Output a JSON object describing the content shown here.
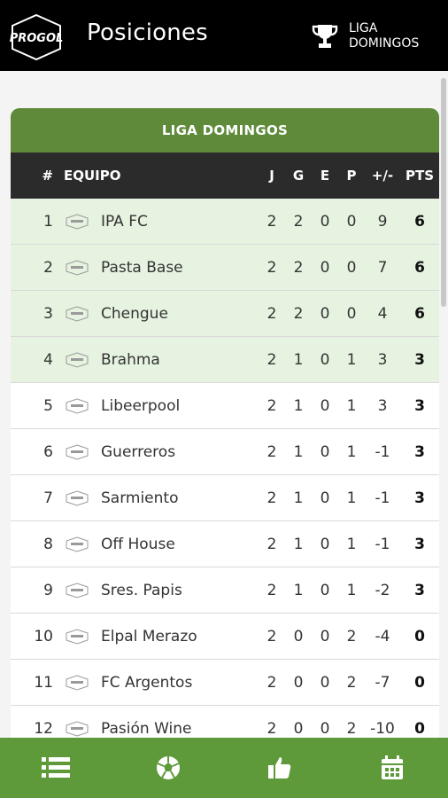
{
  "header": {
    "logo_text": "PROGOL",
    "title": "Posiciones",
    "league_button_label": "LIGA\nDOMINGOS"
  },
  "table": {
    "title": "LIGA DOMINGOS",
    "columns": [
      "#",
      "EQUIPO",
      "J",
      "G",
      "E",
      "P",
      "+/-",
      "PTS"
    ],
    "rows": [
      {
        "pos": "1",
        "team": "IPA FC",
        "j": "2",
        "g": "2",
        "e": "0",
        "p": "0",
        "diff": "9",
        "pts": "6",
        "highlight": true
      },
      {
        "pos": "2",
        "team": "Pasta Base",
        "j": "2",
        "g": "2",
        "e": "0",
        "p": "0",
        "diff": "7",
        "pts": "6",
        "highlight": true
      },
      {
        "pos": "3",
        "team": "Chengue",
        "j": "2",
        "g": "2",
        "e": "0",
        "p": "0",
        "diff": "4",
        "pts": "6",
        "highlight": true
      },
      {
        "pos": "4",
        "team": "Brahma",
        "j": "2",
        "g": "1",
        "e": "0",
        "p": "1",
        "diff": "3",
        "pts": "3",
        "highlight": true
      },
      {
        "pos": "5",
        "team": "Libeerpool",
        "j": "2",
        "g": "1",
        "e": "0",
        "p": "1",
        "diff": "3",
        "pts": "3",
        "highlight": false
      },
      {
        "pos": "6",
        "team": "Guerreros",
        "j": "2",
        "g": "1",
        "e": "0",
        "p": "1",
        "diff": "-1",
        "pts": "3",
        "highlight": false
      },
      {
        "pos": "7",
        "team": "Sarmiento",
        "j": "2",
        "g": "1",
        "e": "0",
        "p": "1",
        "diff": "-1",
        "pts": "3",
        "highlight": false
      },
      {
        "pos": "8",
        "team": "Off House",
        "j": "2",
        "g": "1",
        "e": "0",
        "p": "1",
        "diff": "-1",
        "pts": "3",
        "highlight": false
      },
      {
        "pos": "9",
        "team": "Sres. Papis",
        "j": "2",
        "g": "1",
        "e": "0",
        "p": "1",
        "diff": "-2",
        "pts": "3",
        "highlight": false
      },
      {
        "pos": "10",
        "team": "Elpal Merazo",
        "j": "2",
        "g": "0",
        "e": "0",
        "p": "2",
        "diff": "-4",
        "pts": "0",
        "highlight": false
      },
      {
        "pos": "11",
        "team": "FC Argentos",
        "j": "2",
        "g": "0",
        "e": "0",
        "p": "2",
        "diff": "-7",
        "pts": "0",
        "highlight": false
      },
      {
        "pos": "12",
        "team": "Pasión Wine",
        "j": "2",
        "g": "0",
        "e": "0",
        "p": "2",
        "diff": "-10",
        "pts": "0",
        "highlight": false
      }
    ]
  },
  "bottom_nav": [
    {
      "name": "standings-nav-button",
      "icon": "list-icon"
    },
    {
      "name": "matches-nav-button",
      "icon": "soccer-ball-icon"
    },
    {
      "name": "likes-nav-button",
      "icon": "thumbs-up-icon"
    },
    {
      "name": "calendar-nav-button",
      "icon": "calendar-icon"
    }
  ],
  "colors": {
    "header_bg": "#000000",
    "accent_green": "#5e9a3a",
    "card_title_green": "#5e8a3a",
    "table_header_bg": "#2b2b2b",
    "highlight_row": "#e6f3e0"
  }
}
